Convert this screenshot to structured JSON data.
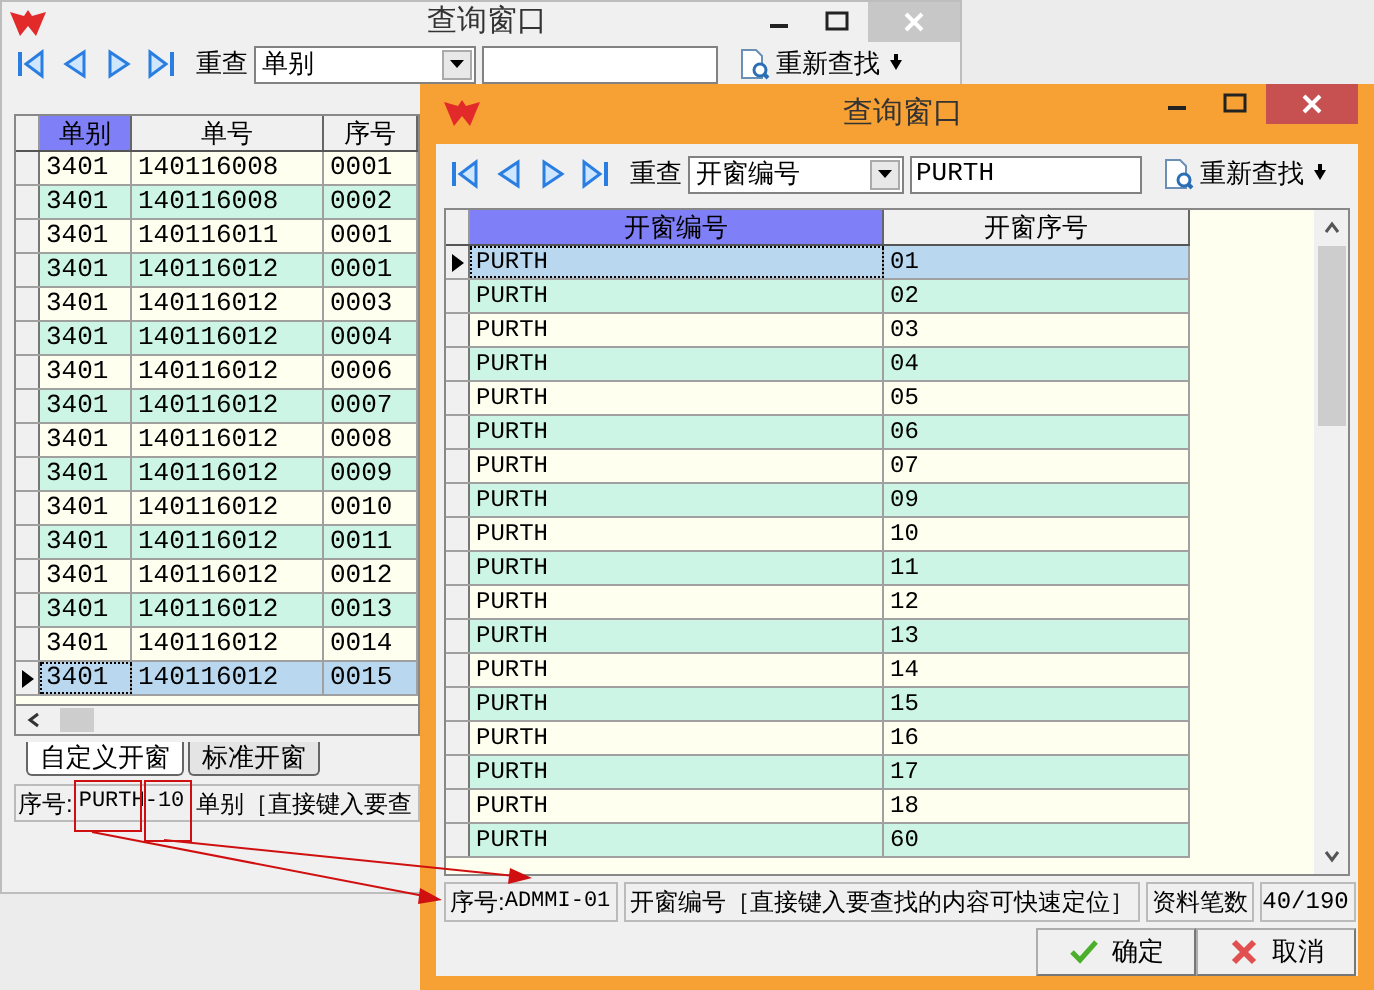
{
  "back_window": {
    "title": "查询窗口",
    "toolbar": {
      "requery_label": "重查",
      "field_combo": "单别",
      "button": "重新查找"
    },
    "grid": {
      "columns": [
        {
          "label": "单别",
          "selected": true
        },
        {
          "label": "单号",
          "selected": false
        },
        {
          "label": "序号",
          "selected": false
        }
      ],
      "rows": [
        {
          "cells": [
            "3401",
            "140116008",
            "0001"
          ],
          "selected": false
        },
        {
          "cells": [
            "3401",
            "140116008",
            "0002"
          ],
          "selected": false
        },
        {
          "cells": [
            "3401",
            "140116011",
            "0001"
          ],
          "selected": false
        },
        {
          "cells": [
            "3401",
            "140116012",
            "0001"
          ],
          "selected": false
        },
        {
          "cells": [
            "3401",
            "140116012",
            "0003"
          ],
          "selected": false
        },
        {
          "cells": [
            "3401",
            "140116012",
            "0004"
          ],
          "selected": false
        },
        {
          "cells": [
            "3401",
            "140116012",
            "0006"
          ],
          "selected": false
        },
        {
          "cells": [
            "3401",
            "140116012",
            "0007"
          ],
          "selected": false
        },
        {
          "cells": [
            "3401",
            "140116012",
            "0008"
          ],
          "selected": false
        },
        {
          "cells": [
            "3401",
            "140116012",
            "0009"
          ],
          "selected": false
        },
        {
          "cells": [
            "3401",
            "140116012",
            "0010"
          ],
          "selected": false
        },
        {
          "cells": [
            "3401",
            "140116012",
            "0011"
          ],
          "selected": false
        },
        {
          "cells": [
            "3401",
            "140116012",
            "0012"
          ],
          "selected": false
        },
        {
          "cells": [
            "3401",
            "140116012",
            "0013"
          ],
          "selected": false
        },
        {
          "cells": [
            "3401",
            "140116012",
            "0014"
          ],
          "selected": false
        },
        {
          "cells": [
            "3401",
            "140116012",
            "0015"
          ],
          "selected": true
        }
      ]
    },
    "tabs": [
      {
        "label": "自定义开窗",
        "selected": true
      },
      {
        "label": "标准开窗",
        "selected": false
      }
    ],
    "status": {
      "key_label": "序号:",
      "key_value": "PURTH-10",
      "hint": "单别［直接键入要查"
    }
  },
  "front_window": {
    "title": "查询窗口",
    "toolbar": {
      "requery_label": "重查",
      "field_combo": "开窗编号",
      "search_value": "PURTH",
      "button": "重新查找"
    },
    "grid": {
      "columns": [
        {
          "label": "开窗编号",
          "selected": true
        },
        {
          "label": "开窗序号",
          "selected": false
        }
      ],
      "rows": [
        {
          "cells": [
            "PURTH",
            "01"
          ],
          "selected": true
        },
        {
          "cells": [
            "PURTH",
            "02"
          ],
          "selected": false
        },
        {
          "cells": [
            "PURTH",
            "03"
          ],
          "selected": false
        },
        {
          "cells": [
            "PURTH",
            "04"
          ],
          "selected": false
        },
        {
          "cells": [
            "PURTH",
            "05"
          ],
          "selected": false
        },
        {
          "cells": [
            "PURTH",
            "06"
          ],
          "selected": false
        },
        {
          "cells": [
            "PURTH",
            "07"
          ],
          "selected": false
        },
        {
          "cells": [
            "PURTH",
            "09"
          ],
          "selected": false
        },
        {
          "cells": [
            "PURTH",
            "10"
          ],
          "selected": false
        },
        {
          "cells": [
            "PURTH",
            "11"
          ],
          "selected": false
        },
        {
          "cells": [
            "PURTH",
            "12"
          ],
          "selected": false
        },
        {
          "cells": [
            "PURTH",
            "13"
          ],
          "selected": false
        },
        {
          "cells": [
            "PURTH",
            "14"
          ],
          "selected": false
        },
        {
          "cells": [
            "PURTH",
            "15"
          ],
          "selected": false
        },
        {
          "cells": [
            "PURTH",
            "16"
          ],
          "selected": false
        },
        {
          "cells": [
            "PURTH",
            "17"
          ],
          "selected": false
        },
        {
          "cells": [
            "PURTH",
            "18"
          ],
          "selected": false
        },
        {
          "cells": [
            "PURTH",
            "60"
          ],
          "selected": false
        }
      ]
    },
    "status_bar": {
      "key_label": "序号:",
      "key_value": "ADMMI-01",
      "hint": "开窗编号［直接键入要查找的内容可快速定位］",
      "count_label": "资料笔数",
      "count": "40/190"
    },
    "buttons": [
      {
        "label": "确定",
        "kind": "ok"
      },
      {
        "label": "取消",
        "kind": "cancel"
      }
    ]
  }
}
